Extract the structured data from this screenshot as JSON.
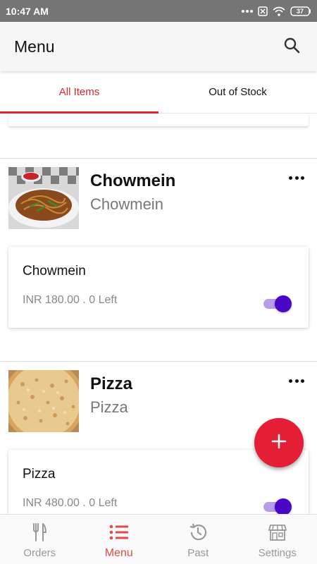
{
  "status_bar": {
    "time": "10:47 AM",
    "battery": "37"
  },
  "app_bar": {
    "title": "Menu"
  },
  "tabs": [
    {
      "label": "All Items",
      "active": true
    },
    {
      "label": "Out of Stock",
      "active": false
    }
  ],
  "items": [
    {
      "name": "Chowmein",
      "subtitle": "Chowmein",
      "variant": {
        "name": "Chowmein",
        "price_line": "INR 180.00 . 0 Left",
        "in_stock": true
      }
    },
    {
      "name": "Pizza",
      "subtitle": "Pizza",
      "variant": {
        "name": "Pizza",
        "price_line": "INR 480.00 . 0 Left",
        "in_stock": true
      }
    }
  ],
  "fab": {
    "icon": "plus-icon"
  },
  "bottom_nav": [
    {
      "label": "Orders",
      "icon": "fork-knife-icon",
      "active": false
    },
    {
      "label": "Menu",
      "icon": "list-icon",
      "active": true
    },
    {
      "label": "Past",
      "icon": "history-icon",
      "active": false
    },
    {
      "label": "Settings",
      "icon": "store-icon",
      "active": false
    }
  ],
  "colors": {
    "accent": "#d9262f",
    "toggle_on": "#4b07c6",
    "fab": "#e31e35",
    "status_bar": "#757575"
  }
}
